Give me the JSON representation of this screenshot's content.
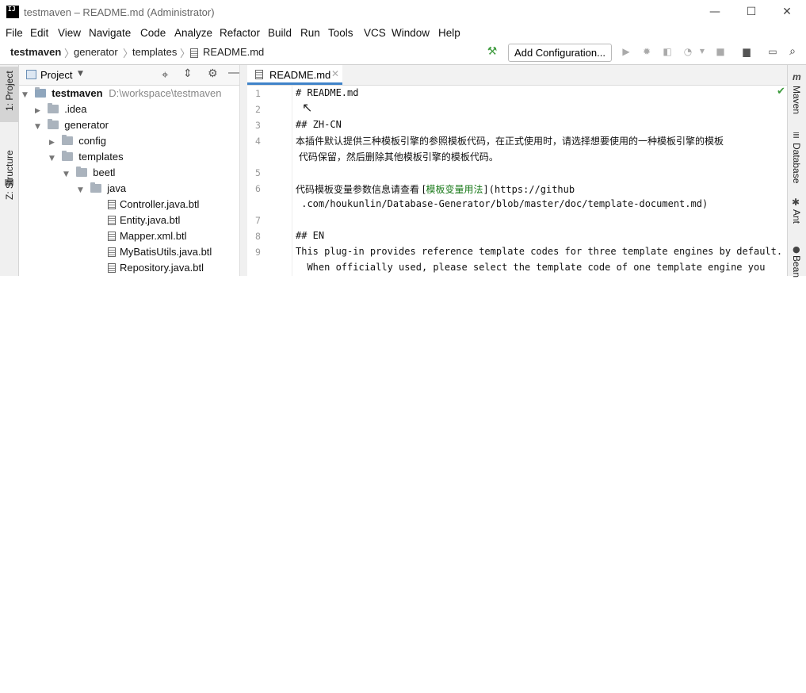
{
  "window": {
    "title": "testmaven – README.md (Administrator)",
    "logo_text": "IJ",
    "controls": {
      "minimize": "—",
      "maximize": "☐",
      "close": "✕"
    }
  },
  "menu": [
    "File",
    "Edit",
    "View",
    "Navigate",
    "Code",
    "Analyze",
    "Refactor",
    "Build",
    "Run",
    "Tools",
    "VCS",
    "Window",
    "Help"
  ],
  "breadcrumb": {
    "items": [
      "testmaven",
      "generator",
      "templates",
      "README.md"
    ]
  },
  "toolbar": {
    "add_configuration": "Add Configuration..."
  },
  "left_strip": {
    "project": "1: Project",
    "structure": "Z: Structure"
  },
  "project_panel": {
    "title": "Project",
    "tree": [
      {
        "label": "testmaven",
        "path": "D:\\workspace\\testmaven",
        "arrow": "▼",
        "kind": "module"
      },
      {
        "label": ".idea",
        "arrow": "▶",
        "kind": "folder"
      },
      {
        "label": "generator",
        "arrow": "▼",
        "kind": "folder"
      },
      {
        "label": "config",
        "arrow": "▶",
        "kind": "folder"
      },
      {
        "label": "templates",
        "arrow": "▼",
        "kind": "folder"
      },
      {
        "label": "beetl",
        "arrow": "▼",
        "kind": "folder"
      },
      {
        "label": "java",
        "arrow": "▼",
        "kind": "folder"
      },
      {
        "label": "Controller.java.btl",
        "arrow": "",
        "kind": "file"
      },
      {
        "label": "Entity.java.btl",
        "arrow": "",
        "kind": "file"
      },
      {
        "label": "Mapper.xml.btl",
        "arrow": "",
        "kind": "file"
      },
      {
        "label": "MyBatisUtils.java.btl",
        "arrow": "",
        "kind": "file"
      },
      {
        "label": "Repository.java.btl",
        "arrow": "",
        "kind": "file"
      }
    ]
  },
  "editor": {
    "tab": "README.md",
    "lines": [
      {
        "n": "1",
        "text": "# README.md"
      },
      {
        "n": "2",
        "text": ""
      },
      {
        "n": "3",
        "text": "## ZH-CN"
      },
      {
        "n": "4",
        "text": "本插件默认提供三种模板引擎的参照模板代码，在正式使用时，请选择想要使用的一种模板引擎的模板"
      },
      {
        "n": "",
        "text": " 代码保留，然后删除其他模板引擎的模板代码。"
      },
      {
        "n": "5",
        "text": ""
      },
      {
        "n": "6",
        "pre": "代码模板变量参数信息请查看 [",
        "link": "模板变量用法",
        "post": "](https://github"
      },
      {
        "n": "",
        "text": " .com/houkunlin/Database-Generator/blob/master/doc/template-document.md)"
      },
      {
        "n": "7",
        "text": ""
      },
      {
        "n": "8",
        "text": "## EN"
      },
      {
        "n": "9",
        "text": "This plug-in provides reference template codes for three template engines by default."
      },
      {
        "n": "",
        "text": "  When officially used, please select the template code of one template engine you"
      }
    ]
  },
  "right_strip": {
    "maven": "Maven",
    "database": "Database",
    "ant": "Ant",
    "bean": "Bean"
  },
  "colors": {
    "accent": "#4083c9",
    "link": "#1a7a1a",
    "build_icon": "#3c9a3c"
  }
}
